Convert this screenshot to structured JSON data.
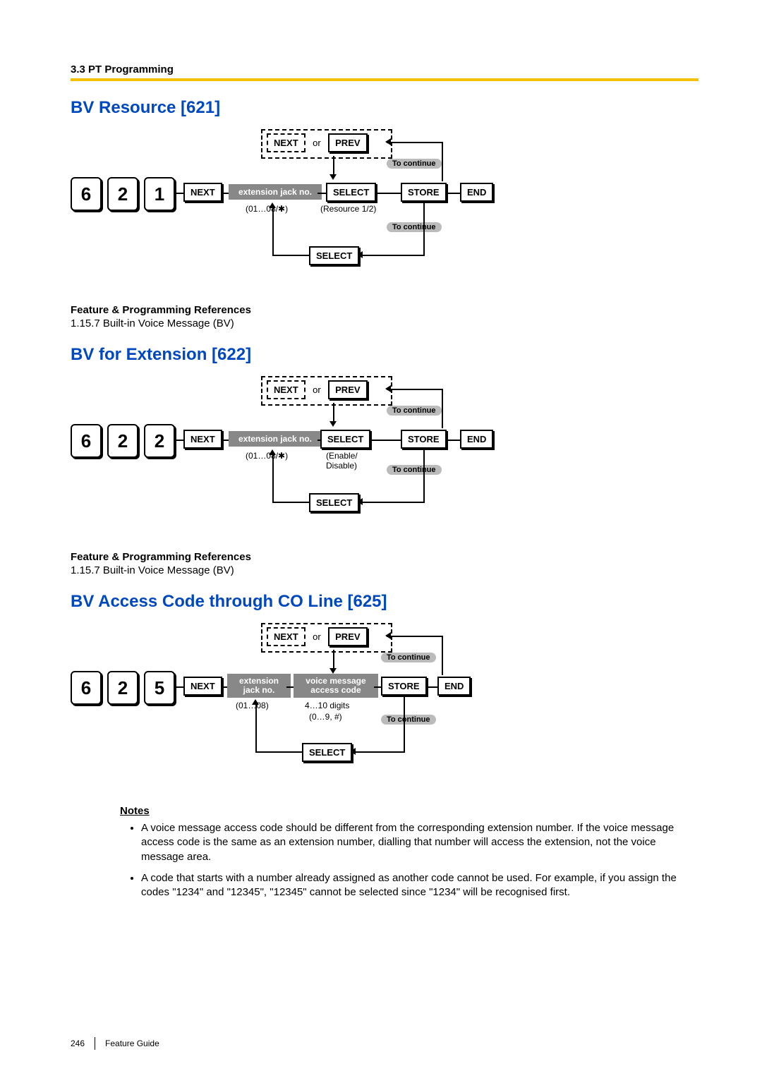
{
  "header": {
    "section": "3.3 PT Programming"
  },
  "footer": {
    "page": "246",
    "label": "Feature Guide"
  },
  "common": {
    "next": "NEXT",
    "prev": "PREV",
    "or": "or",
    "select": "SELECT",
    "store": "STORE",
    "end": "END",
    "to_continue": "To continue"
  },
  "s1": {
    "title": "BV Resource [621]",
    "digits": [
      "6",
      "2",
      "1"
    ],
    "ext_label": "extension jack no.",
    "ext_hint": "(01…08/✱)",
    "select_hint": "(Resource 1/2)",
    "refs_h": "Feature & Programming References",
    "refs_b": "1.15.7 Built-in Voice Message (BV)"
  },
  "s2": {
    "title": "BV for Extension [622]",
    "digits": [
      "6",
      "2",
      "2"
    ],
    "ext_label": "extension jack no.",
    "ext_hint": "(01…08/✱)",
    "select_hint": "(Enable/\nDisable)",
    "refs_h": "Feature & Programming References",
    "refs_b": "1.15.7 Built-in Voice Message (BV)"
  },
  "s3": {
    "title": "BV Access Code through CO Line [625]",
    "digits": [
      "6",
      "2",
      "5"
    ],
    "ext_label": "extension\njack no.",
    "ext_hint": "(01…08)",
    "code_label": "voice message\naccess code",
    "code_hint1": "4…10 digits",
    "code_hint2": "(0…9, #)",
    "notes_h": "Notes",
    "notes": [
      "A voice message access code should be different from the corresponding extension number. If the voice message access code is the same as an extension number, dialling that number will access the extension, not the voice message area.",
      "A code that starts with a number already assigned as another code cannot be used. For example, if you assign the codes \"1234\" and \"12345\", \"12345\" cannot be selected since \"1234\" will be recognised first."
    ]
  }
}
